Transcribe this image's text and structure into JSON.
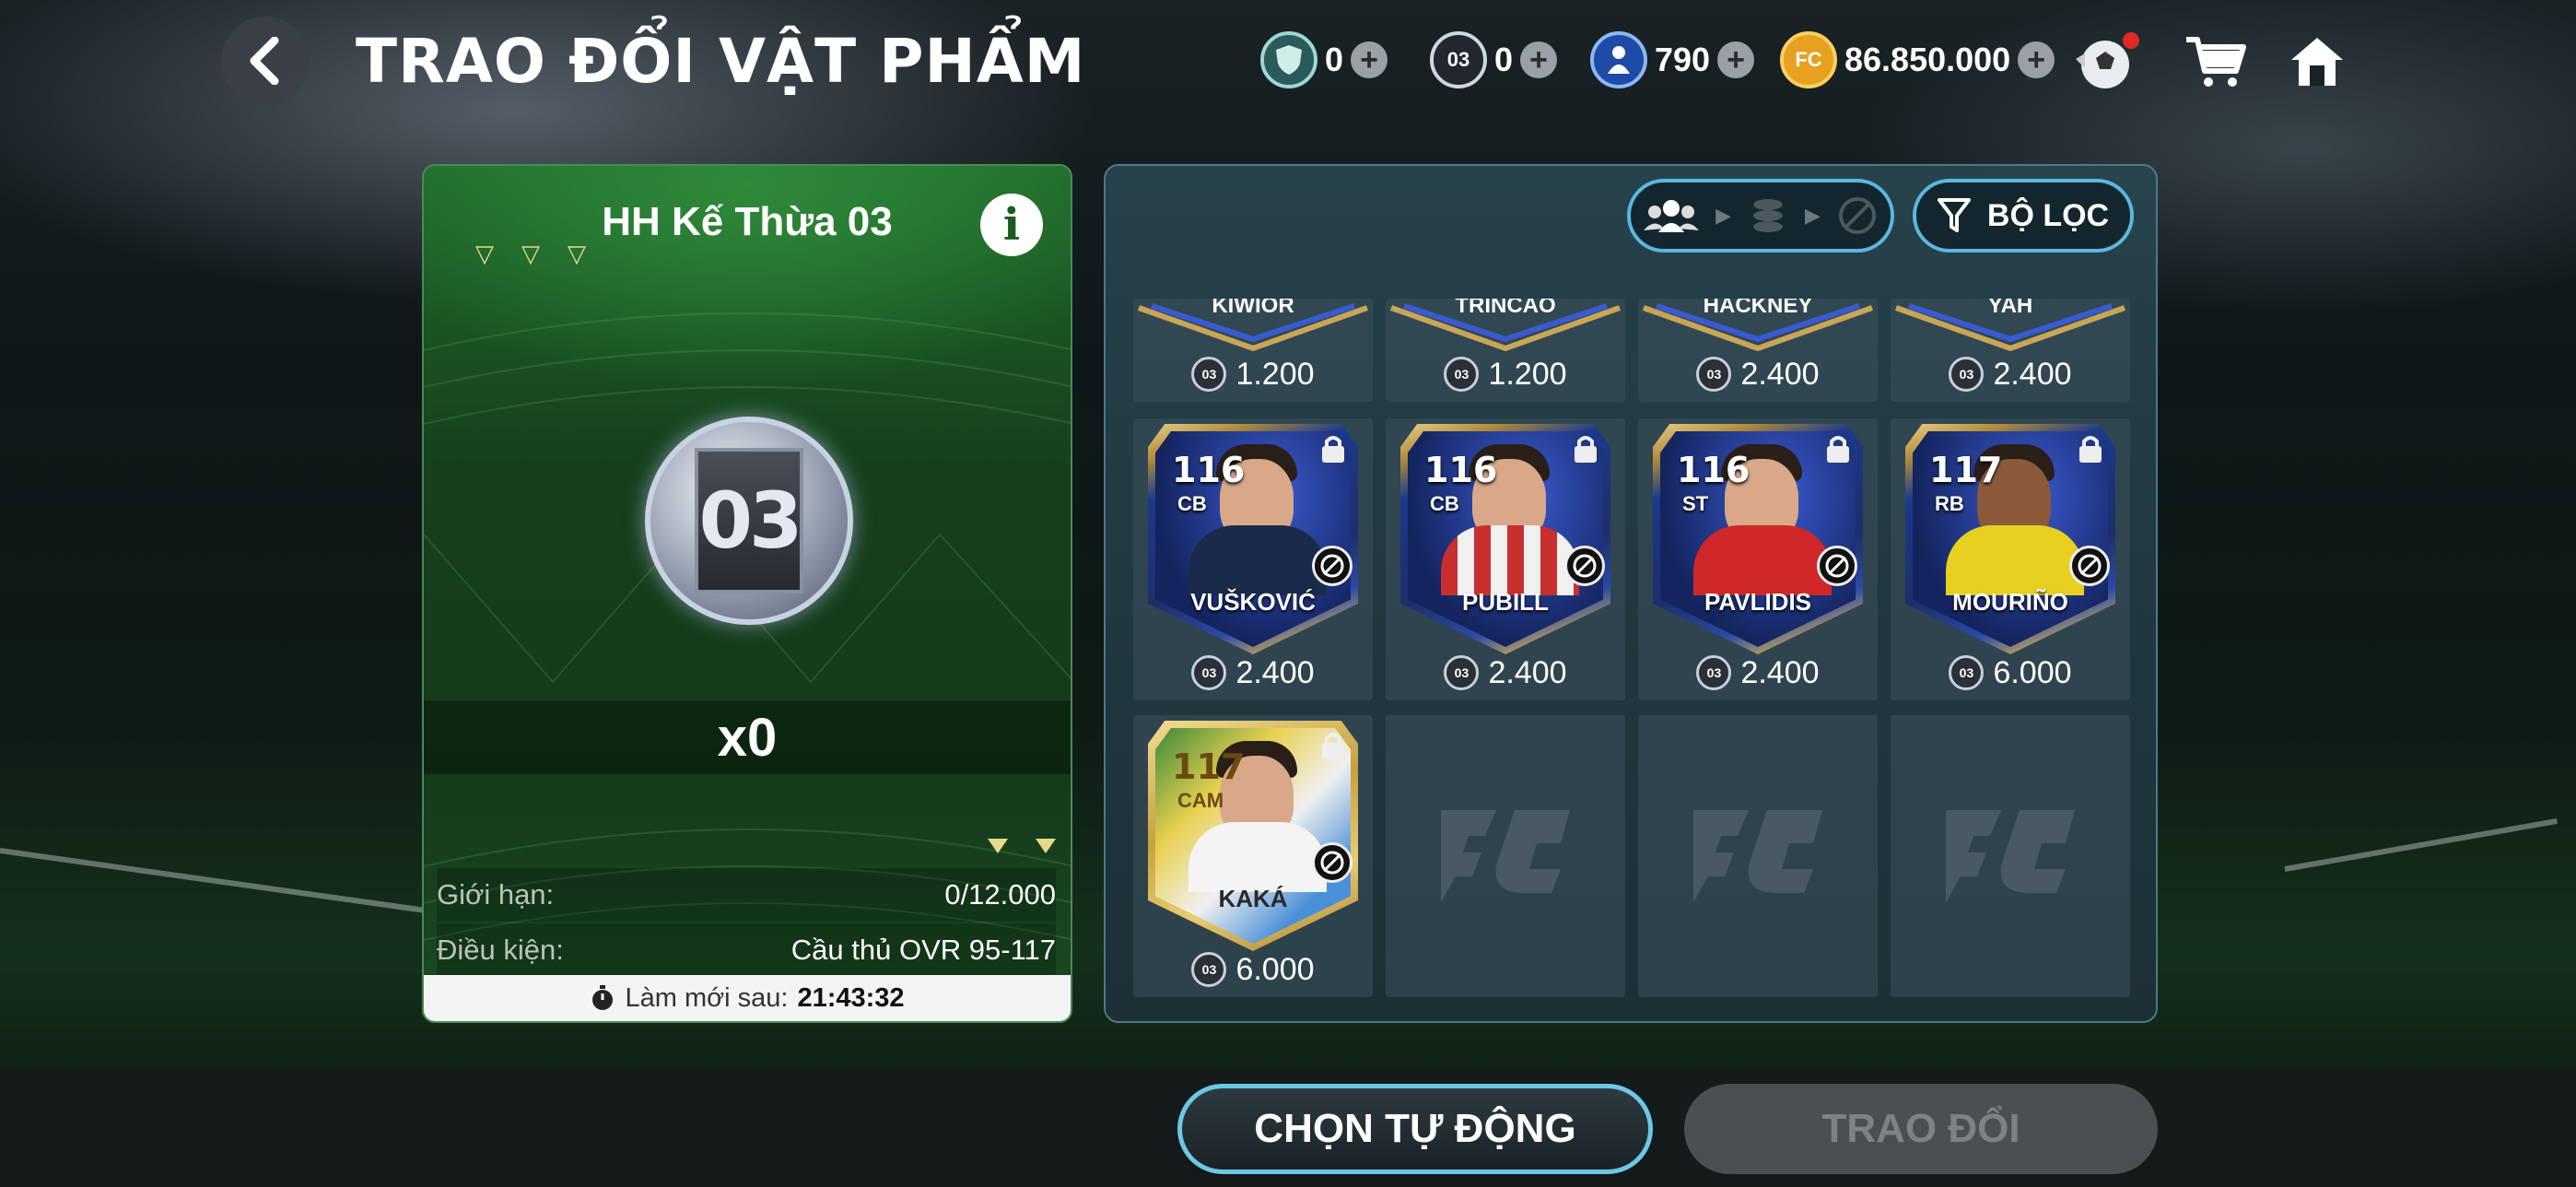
{
  "header": {
    "title": "TRAO ĐỔI VẬT PHẨM",
    "currencies": [
      {
        "icon": "shield-token-icon",
        "value": "0",
        "badge": ""
      },
      {
        "icon": "token-03-icon",
        "value": "0",
        "badge": "03"
      },
      {
        "icon": "player-point-icon",
        "value": "790",
        "badge": ""
      },
      {
        "icon": "fc-coin-icon",
        "value": "86.850.000",
        "badge": "FC"
      }
    ]
  },
  "left_panel": {
    "title": "HH Kế Thừa 03",
    "token_label": "03",
    "quantity": "x0",
    "limit_label": "Giới hạn:",
    "limit_value": "0/12.000",
    "condition_label": "Điều kiện:",
    "condition_value": "Cầu thủ OVR 95-117",
    "refresh_label": "Làm mới sau:",
    "refresh_time": "21:43:32"
  },
  "right_panel": {
    "filter_label": "BỘ LỌC",
    "price_coin_badge": "03",
    "partial_row": [
      {
        "name": "KIWIOR",
        "price": "1.200"
      },
      {
        "name": "TRINCAO",
        "price": "1.200"
      },
      {
        "name": "HACKNEY",
        "price": "2.400"
      },
      {
        "name": "YAH",
        "price": "2.400"
      }
    ],
    "players": [
      {
        "ovr": "116",
        "pos": "CB",
        "name": "VUŠKOVIĆ",
        "price": "2.400",
        "shirt": "#1a2a4a"
      },
      {
        "ovr": "116",
        "pos": "CB",
        "name": "PUBILL",
        "price": "2.400",
        "shirt": "#c83030"
      },
      {
        "ovr": "116",
        "pos": "ST",
        "name": "PAVLIDIS",
        "price": "2.400",
        "shirt": "#d02828"
      },
      {
        "ovr": "117",
        "pos": "RB",
        "name": "MOURIÑO",
        "price": "6.000",
        "shirt": "#e8d020"
      },
      {
        "ovr": "117",
        "pos": "CAM",
        "name": "KAKÁ",
        "price": "6.000",
        "shirt": "#f0f0f0"
      }
    ]
  },
  "footer": {
    "auto_select_label": "CHỌN TỰ ĐỘNG",
    "trade_label": "TRAO ĐỔI"
  }
}
